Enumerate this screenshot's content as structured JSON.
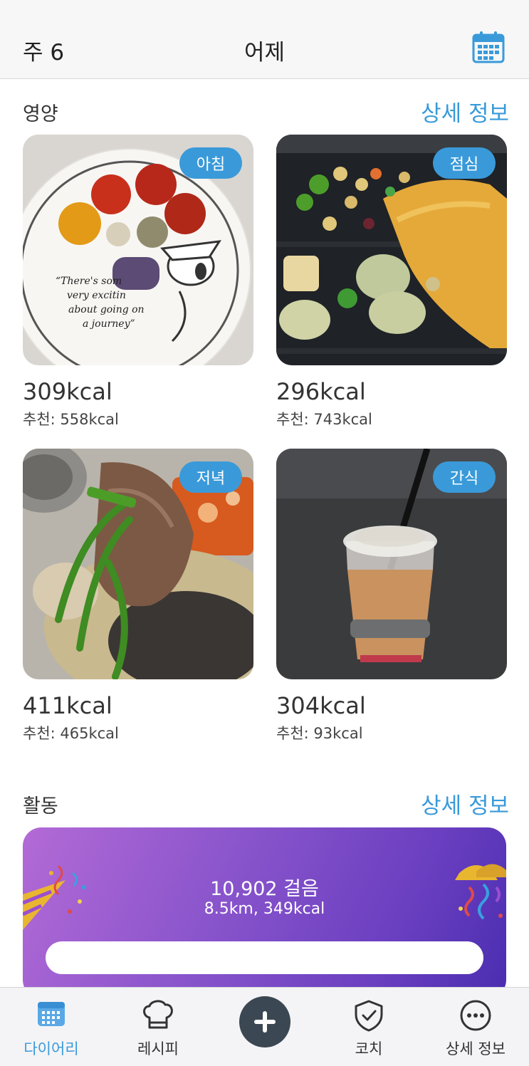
{
  "header": {
    "week": "주 6",
    "title": "어제"
  },
  "nutrition": {
    "section_title": "영양",
    "details_link": "상세 정보",
    "meals": [
      {
        "badge": "아침",
        "kcal": "309kcal",
        "recommended": "추천: 558kcal"
      },
      {
        "badge": "점심",
        "kcal": "296kcal",
        "recommended": "추천: 743kcal"
      },
      {
        "badge": "저녁",
        "kcal": "411kcal",
        "recommended": "추천: 465kcal"
      },
      {
        "badge": "간식",
        "kcal": "304kcal",
        "recommended": "추천: 93kcal"
      }
    ],
    "plate_text": [
      "“There's som",
      "very excitin",
      "about going on",
      "a journey”"
    ]
  },
  "activity": {
    "section_title": "활동",
    "details_link": "상세 정보",
    "steps": "10,902 걸음",
    "distance_kcal": "8.5km, 349kcal"
  },
  "nav": {
    "items": [
      {
        "label": "다이어리",
        "icon": "calendar-icon",
        "active": true
      },
      {
        "label": "레시피",
        "icon": "chef-hat-icon",
        "active": false
      },
      {
        "label": "",
        "icon": "plus-icon",
        "active": false
      },
      {
        "label": "코치",
        "icon": "shield-check-icon",
        "active": false
      },
      {
        "label": "상세 정보",
        "icon": "more-dots-icon",
        "active": false
      }
    ]
  },
  "colors": {
    "accent": "#3a9ad9",
    "add_button": "#3b4752",
    "activity_gradient_start": "#b36ad6",
    "activity_gradient_end": "#4a2db0"
  }
}
